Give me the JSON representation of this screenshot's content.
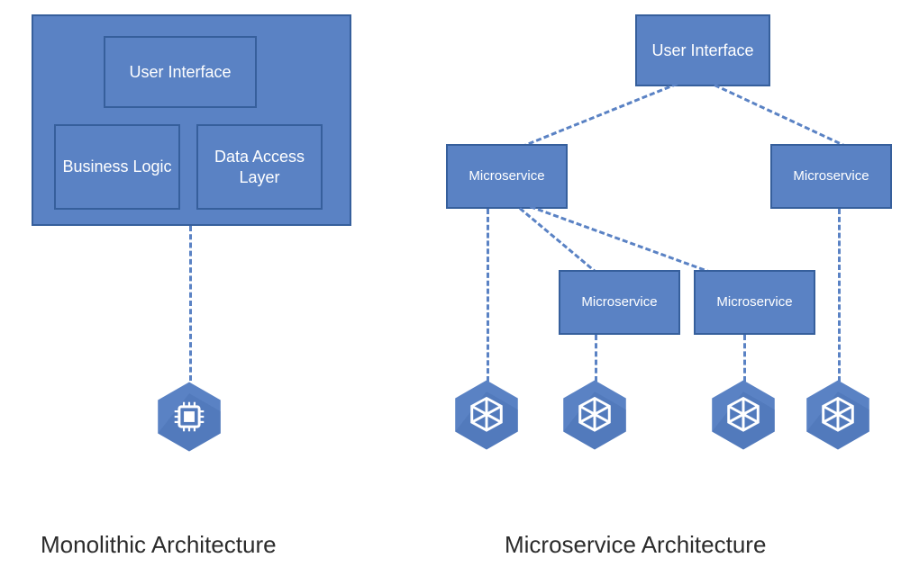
{
  "colors": {
    "box_fill": "#5a82c4",
    "box_border": "#365f9c",
    "hex_fill": "#5a82c4",
    "line": "#5a82c4",
    "text_white": "#ffffff",
    "caption": "#2b2b2b"
  },
  "monolithic": {
    "container_label": "",
    "ui_label": "User Interface",
    "business_label": "Business Logic",
    "data_label": "Data Access Layer",
    "caption": "Monolithic Architecture",
    "hex_icon": "chip-icon"
  },
  "microservice": {
    "ui_label": "User Interface",
    "services": [
      "Microservice",
      "Microservice",
      "Microservice",
      "Microservice"
    ],
    "caption": "Microservice Architecture",
    "hex_icon": "cube-icon"
  }
}
